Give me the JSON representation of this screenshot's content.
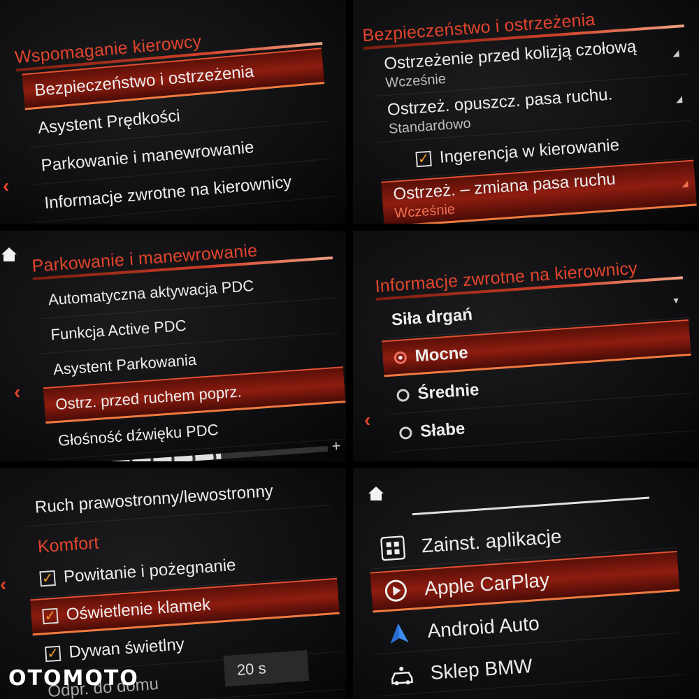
{
  "panel1": {
    "title": "Wspomaganie kierowcy",
    "items": [
      "Bezpieczeństwo i ostrzeżenia",
      "Asystent Prędkości",
      "Parkowanie i manewrowanie",
      "Informacje zwrotne na kierownicy"
    ]
  },
  "panel2": {
    "title": "Bezpieczeństwo i ostrzeżenia",
    "items": [
      {
        "label": "Ostrzeżenie przed kolizją czołową",
        "sub": "Wcześnie"
      },
      {
        "label": "Ostrzeż. opuszcz. pasa ruchu.",
        "sub": "Standardowo"
      },
      {
        "label": "Ingerencja w kierowanie",
        "checked": true
      },
      {
        "label": "Ostrzeż. – zmiana pasa ruchu",
        "sub": "Wcześnie"
      }
    ]
  },
  "panel3": {
    "title": "Parkowanie i manewrowanie",
    "items": [
      "Automatyczna aktywacja PDC",
      "Funkcja Active PDC",
      "Asystent Parkowania",
      "Ostrz. przed ruchem poprz.",
      "Głośność dźwięku PDC"
    ],
    "volume_level": 0.55
  },
  "panel4": {
    "title": "Informacje zwrotne na kierownicy",
    "header": "Siła drgań",
    "options": [
      "Mocne",
      "Średnie",
      "Słabe"
    ]
  },
  "panel5": {
    "item_top": "Ruch prawostronny/lewostronny",
    "section": "Komfort",
    "items": [
      "Powitanie i pożegnanie",
      "Oświetlenie klamek",
      "Dywan świetlny"
    ],
    "partial": "Odpr. do domu",
    "time_value": "20 s"
  },
  "panel6": {
    "items": [
      "Zainst. aplikacje",
      "Apple CarPlay",
      "Android Auto",
      "Sklep BMW"
    ]
  },
  "watermark": "OTOMOTO",
  "colors": {
    "accent": "#e2442c",
    "selected": "#8e1c10",
    "check": "#f0a030"
  }
}
